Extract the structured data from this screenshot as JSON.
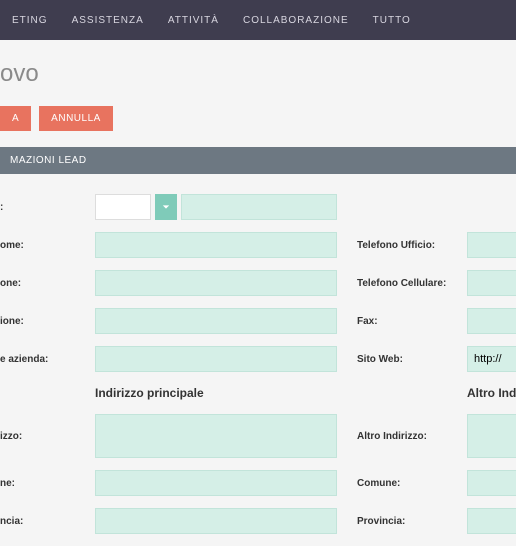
{
  "nav": [
    "ETING",
    "ASSISTENZA",
    "ATTIVITÀ",
    "COLLABORAZIONE",
    "TUTTO"
  ],
  "title": "ovo",
  "btns": {
    "save": "A",
    "cancel": "ANNULLA"
  },
  "section": "MAZIONI LEAD",
  "left": {
    "nome_lbl": ":",
    "cognome_lbl": "ome:",
    "mansione_lbl": "one:",
    "posizione_lbl": "ione:",
    "azienda_lbl": "e azienda:",
    "sub": "Indirizzo principale",
    "indirizzo_lbl": "izzo:",
    "comune_lbl": "ne:",
    "provincia_lbl": "ncia:"
  },
  "right": {
    "tel_uff_lbl": "Telefono Ufficio:",
    "tel_cell_lbl": "Telefono Cellulare:",
    "fax_lbl": "Fax:",
    "sito_lbl": "Sito Web:",
    "sito_val": "http://",
    "sub": "Altro Indirizzo",
    "indirizzo_lbl": "Altro Indirizzo:",
    "comune_lbl": "Comune:",
    "provincia_lbl": "Provincia:"
  }
}
